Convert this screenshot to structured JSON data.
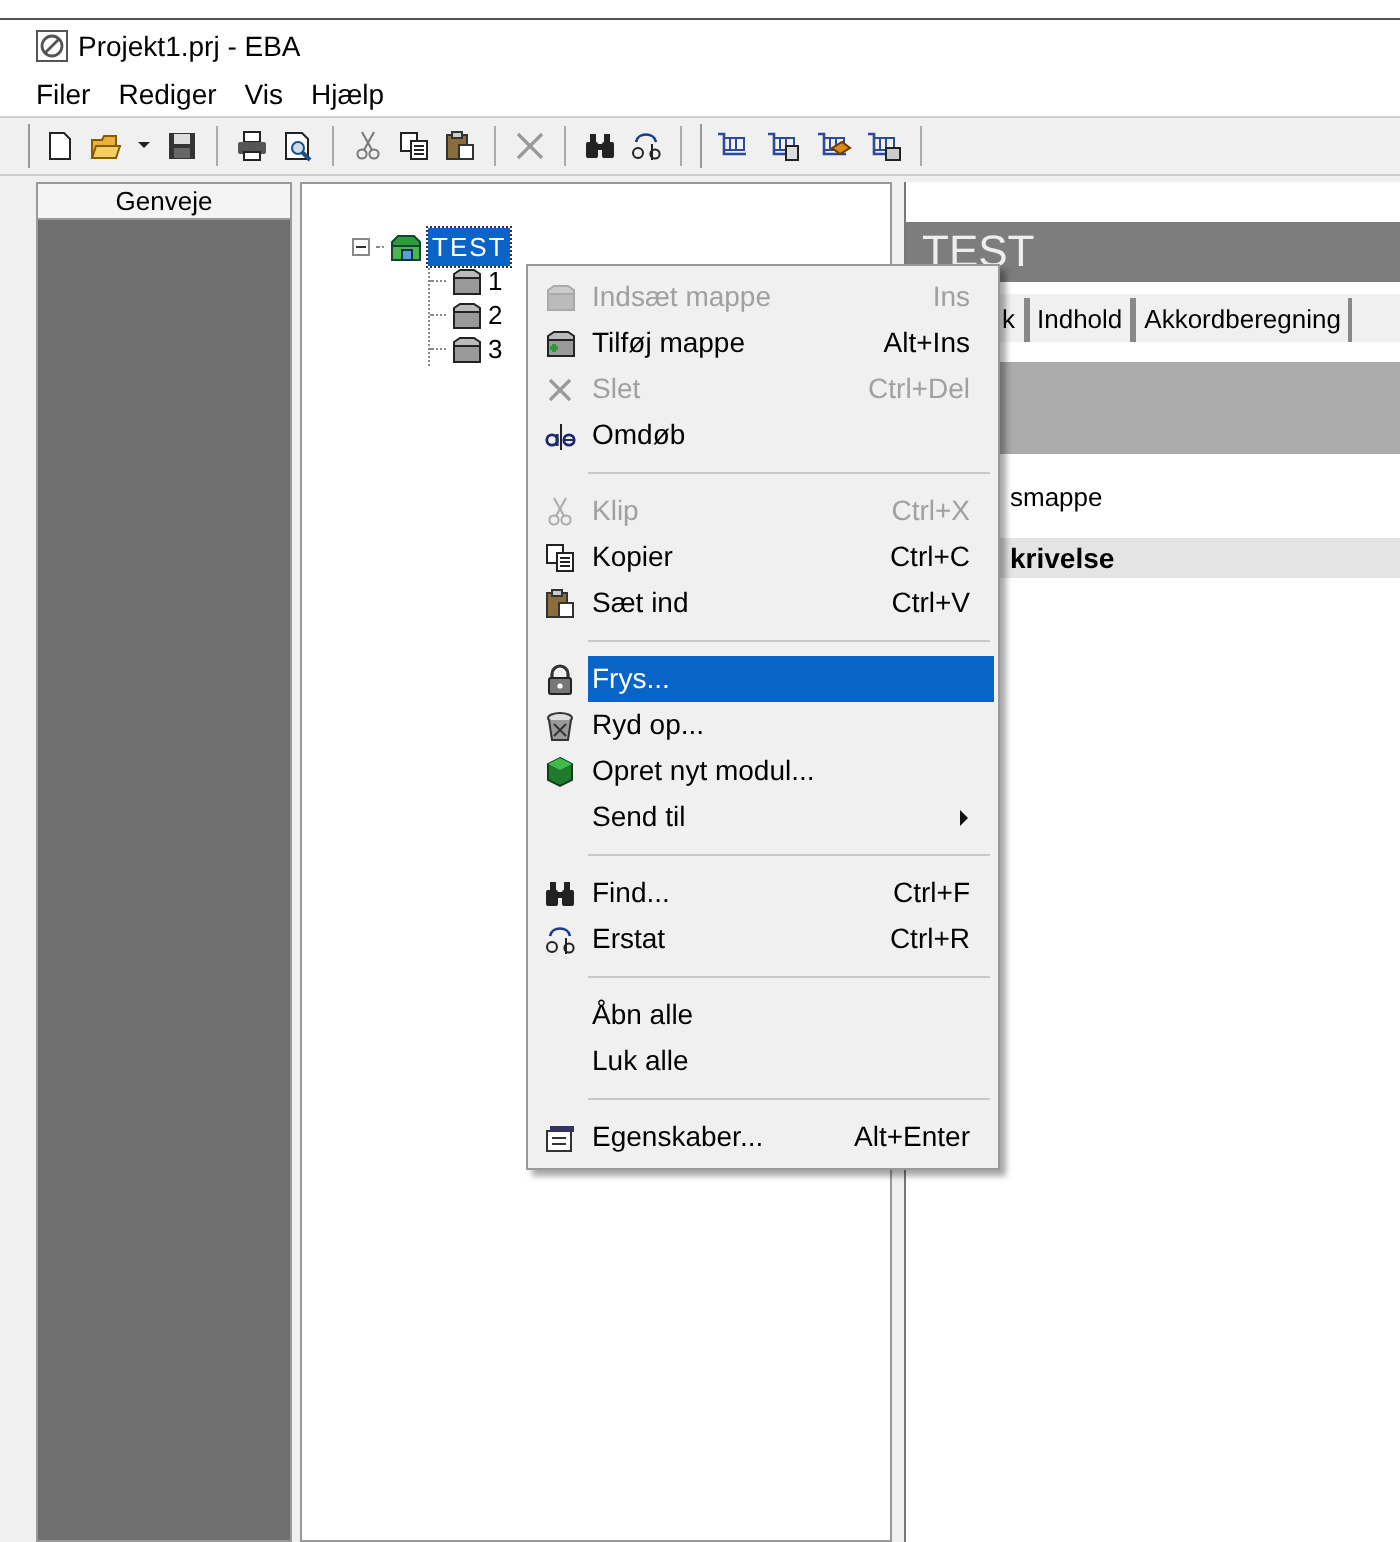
{
  "window": {
    "title": "Projekt1.prj - EBA"
  },
  "menu_bar": [
    {
      "label": "Filer"
    },
    {
      "label": "Rediger"
    },
    {
      "label": "Vis"
    },
    {
      "label": "Hjælp"
    }
  ],
  "sidebar": {
    "title": "Genveje"
  },
  "tree": {
    "items": [
      {
        "label": "TEST",
        "selected": true,
        "expanded": true,
        "children": [
          {
            "label": "1",
            "selected": false
          },
          {
            "label": "2",
            "selected": false
          },
          {
            "label": "3",
            "selected": false
          }
        ]
      }
    ]
  },
  "panel": {
    "title": "TEST",
    "tabs": [
      {
        "label": "k"
      },
      {
        "label": "Indhold"
      },
      {
        "label": "Akkordberegning"
      }
    ],
    "rows": [
      {
        "kind": "field",
        "text": "smappe"
      },
      {
        "kind": "heading",
        "text": "krivelse"
      }
    ]
  },
  "context_menu": {
    "items": [
      {
        "kind": "item",
        "label": "Indsæt mappe",
        "shortcut": "Ins",
        "disabled": true,
        "selected": false
      },
      {
        "kind": "item",
        "label": "Tilføj mappe",
        "shortcut": "Alt+Ins",
        "disabled": false,
        "selected": false
      },
      {
        "kind": "item",
        "label": "Slet",
        "shortcut": "Ctrl+Del",
        "disabled": true,
        "selected": false
      },
      {
        "kind": "item",
        "label": "Omdøb",
        "disabled": false,
        "selected": false
      },
      {
        "kind": "separator"
      },
      {
        "kind": "item",
        "label": "Klip",
        "shortcut": "Ctrl+X",
        "disabled": true,
        "selected": false
      },
      {
        "kind": "item",
        "label": "Kopier",
        "shortcut": "Ctrl+C",
        "disabled": false,
        "selected": false
      },
      {
        "kind": "item",
        "label": "Sæt ind",
        "shortcut": "Ctrl+V",
        "disabled": false,
        "selected": false
      },
      {
        "kind": "separator"
      },
      {
        "kind": "item",
        "label": "Frys...",
        "disabled": false,
        "selected": true
      },
      {
        "kind": "item",
        "label": "Ryd op...",
        "disabled": false,
        "selected": false
      },
      {
        "kind": "item",
        "label": "Opret nyt modul...",
        "disabled": false,
        "selected": false
      },
      {
        "kind": "item",
        "label": "Send til",
        "submenu": true,
        "disabled": false,
        "selected": false
      },
      {
        "kind": "separator"
      },
      {
        "kind": "item",
        "label": "Find...",
        "shortcut": "Ctrl+F",
        "disabled": false,
        "selected": false
      },
      {
        "kind": "item",
        "label": "Erstat",
        "shortcut": "Ctrl+R",
        "disabled": false,
        "selected": false
      },
      {
        "kind": "separator"
      },
      {
        "kind": "item",
        "label": "Åbn alle",
        "disabled": false,
        "selected": false
      },
      {
        "kind": "item",
        "label": "Luk alle",
        "disabled": false,
        "selected": false
      },
      {
        "kind": "separator"
      },
      {
        "kind": "item",
        "label": "Egenskaber...",
        "shortcut": "Alt+Enter",
        "disabled": false,
        "selected": false
      }
    ]
  }
}
